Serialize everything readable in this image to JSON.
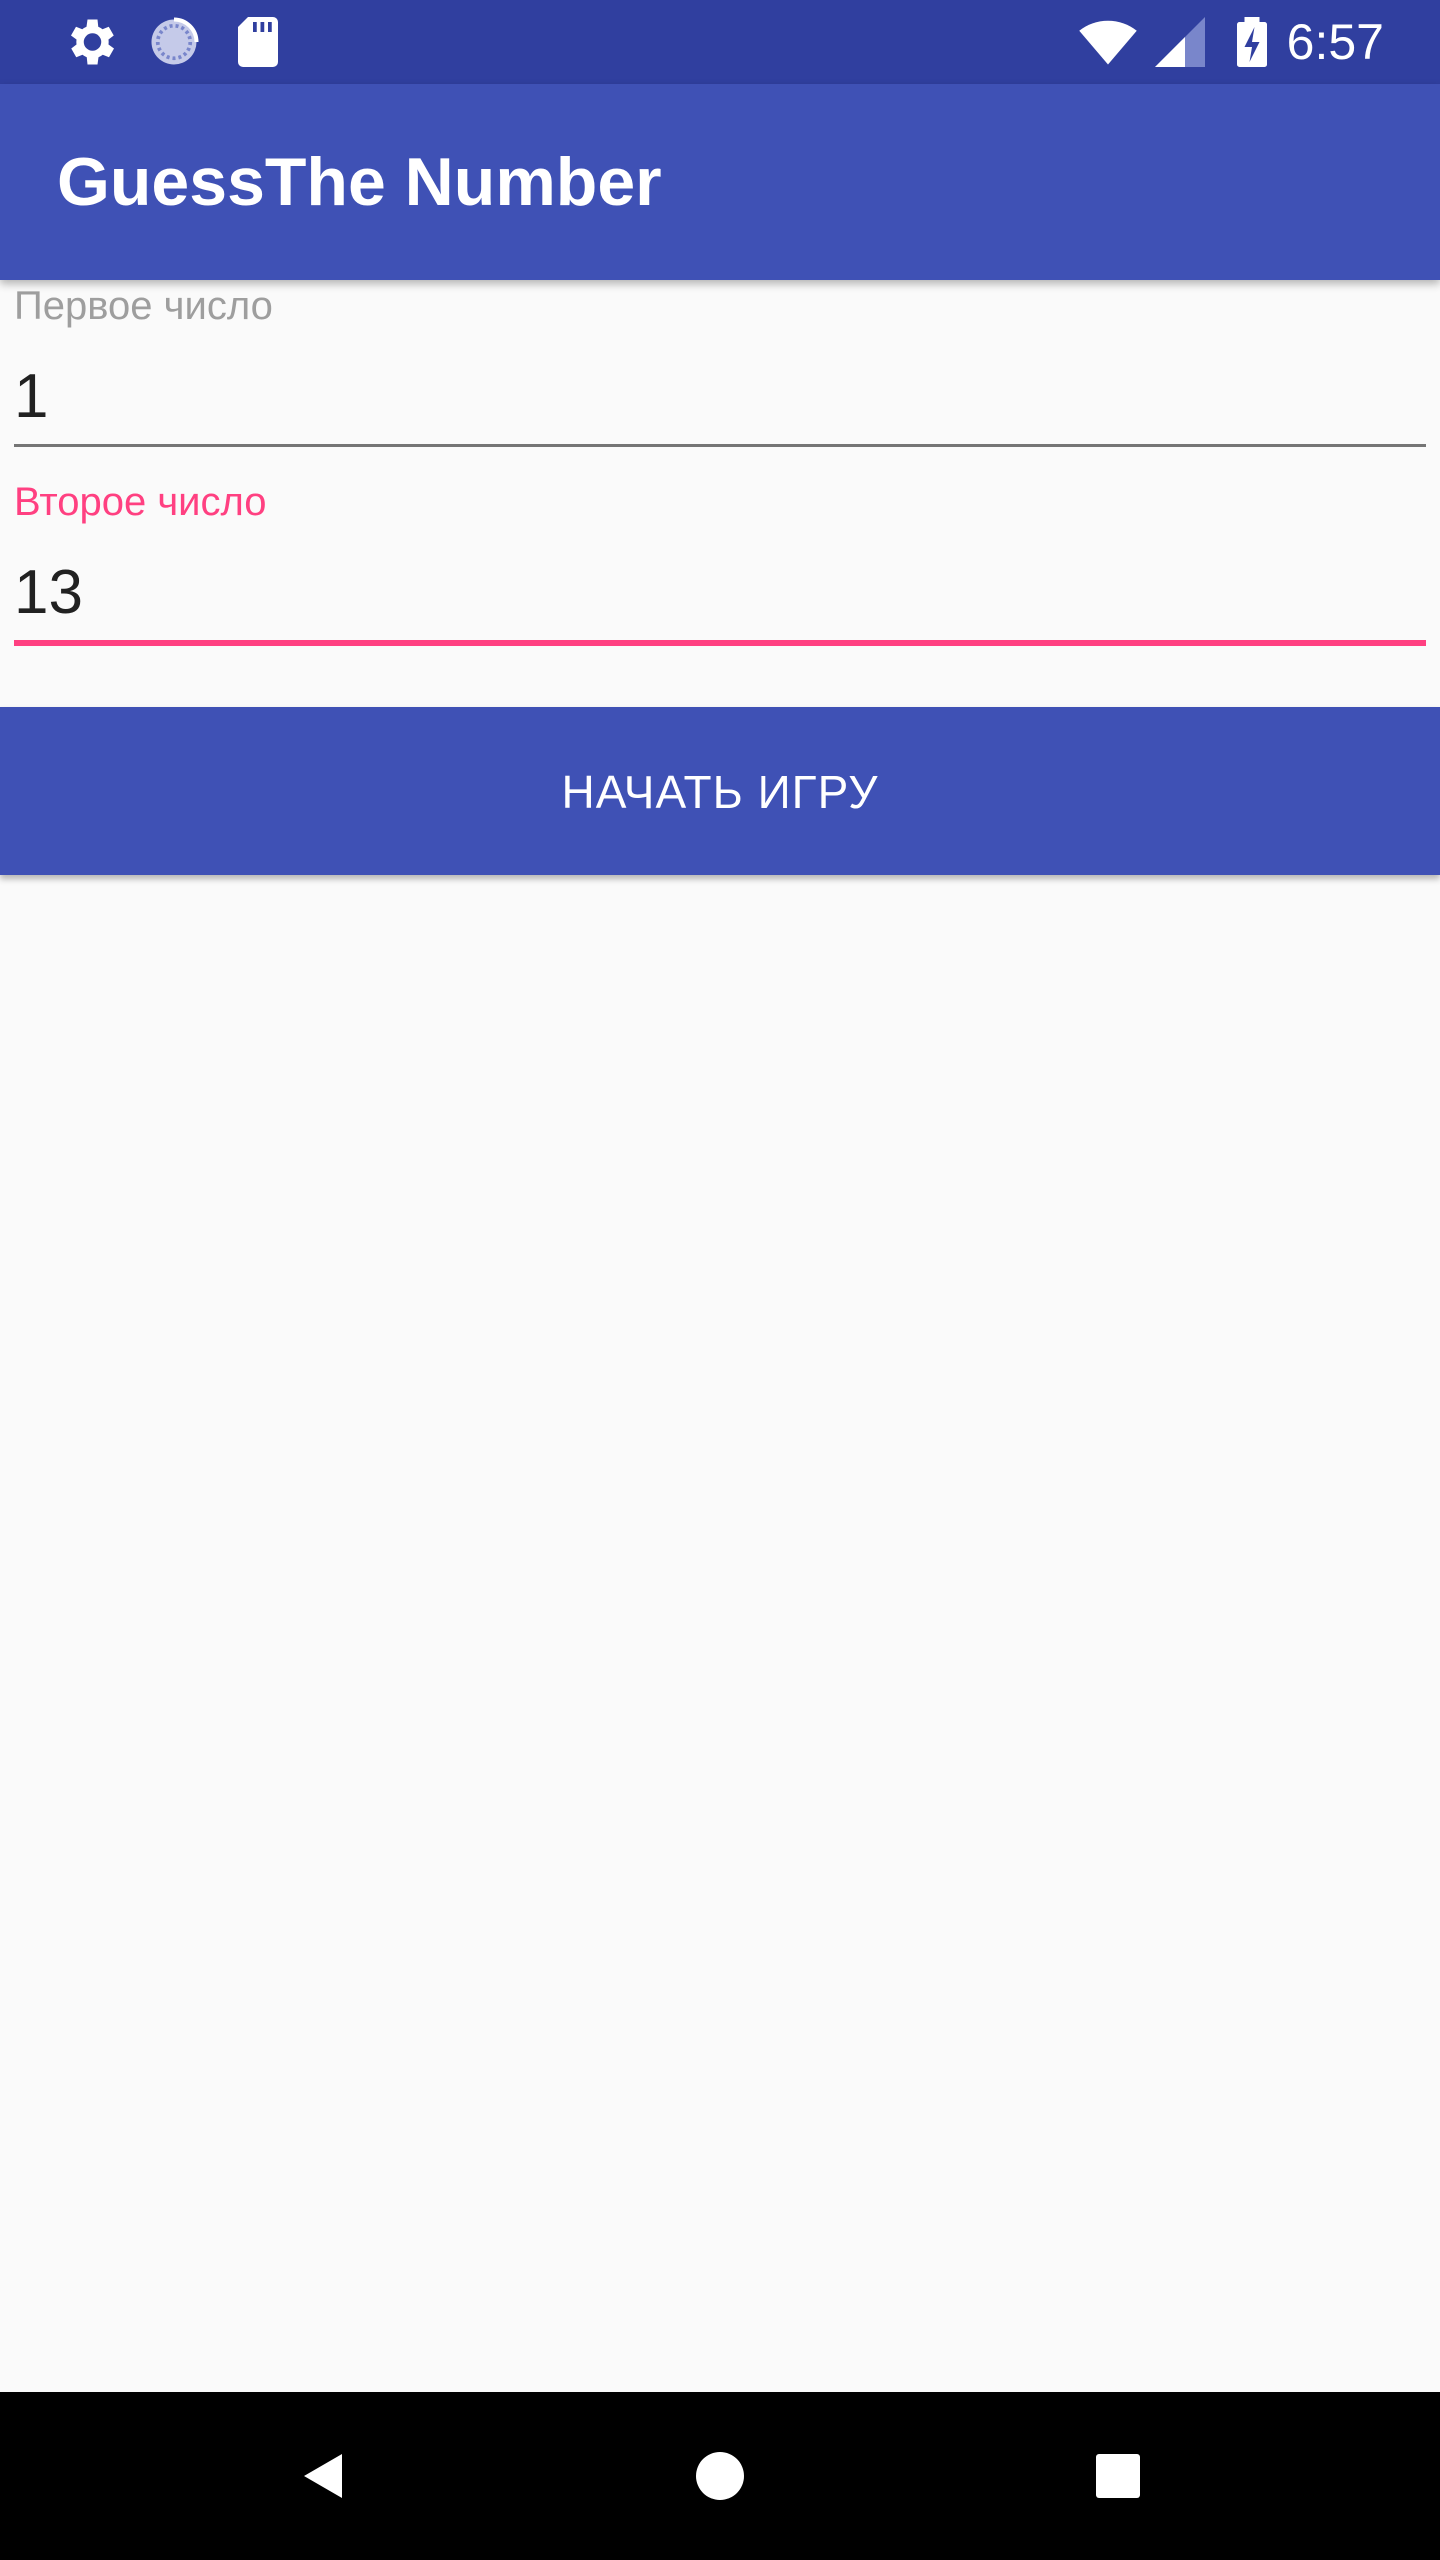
{
  "status_bar": {
    "time": "6:57",
    "icons": [
      "gear-icon",
      "sync-icon",
      "sd-card-icon",
      "wifi-icon",
      "signal-icon",
      "battery-charging-icon"
    ]
  },
  "app_bar": {
    "title": "GuessThe Number"
  },
  "form": {
    "first_number": {
      "label": "Первое число",
      "value": "1"
    },
    "second_number": {
      "label": "Второе число",
      "value": "13"
    },
    "start_button_label": "НАЧАТЬ ИГРУ"
  },
  "nav_bar": {
    "icons": [
      "back-icon",
      "home-icon",
      "recents-icon"
    ]
  },
  "colors": {
    "primary": "#3f51b5",
    "primary_dark": "#303f9f",
    "accent": "#ff4081",
    "label_inactive": "#9e9e9e",
    "underline_inactive": "#757575"
  }
}
